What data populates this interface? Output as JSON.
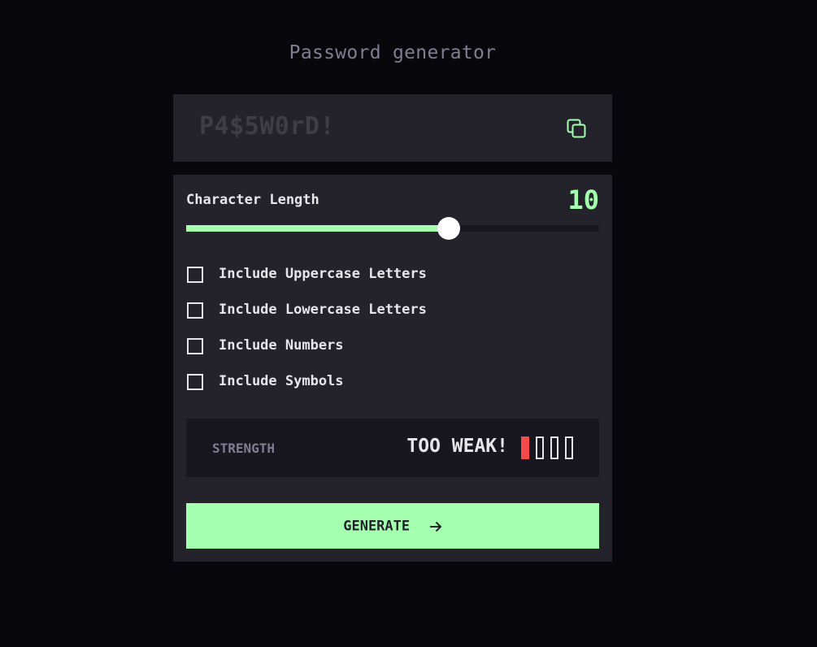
{
  "title": "Password generator",
  "password": {
    "placeholder": "P4$5W0rD!"
  },
  "icons": {
    "copy": "copy-icon",
    "arrow": "arrow-right-icon"
  },
  "length": {
    "label": "Character Length",
    "value": "10",
    "fill_fraction": 0.635
  },
  "options": [
    {
      "label": "Include Uppercase Letters",
      "checked": false
    },
    {
      "label": "Include Lowercase Letters",
      "checked": false
    },
    {
      "label": "Include Numbers",
      "checked": false
    },
    {
      "label": "Include Symbols",
      "checked": false
    }
  ],
  "strength": {
    "label": "STRENGTH",
    "rating": "TOO WEAK!",
    "level": 1,
    "max_level": 4
  },
  "generate": {
    "label": "GENERATE"
  },
  "colors": {
    "background": "#08070B",
    "panel": "#24232C",
    "dark": "#18171F",
    "accent": "#A4FFAF",
    "text": "#E6E5EA",
    "muted": "#817D92",
    "too_weak": "#F64A4A"
  }
}
